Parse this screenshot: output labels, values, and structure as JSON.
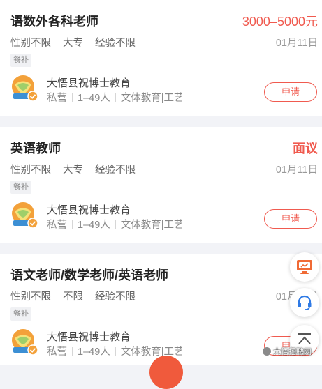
{
  "jobs": [
    {
      "title": "语数外各科老师",
      "salary": "3000–5000元",
      "requirements": [
        "性别不限",
        "大专",
        "经验不限"
      ],
      "date": "01月11日",
      "tag": "餐补",
      "company": {
        "name": "大悟县祝博士教育",
        "info": [
          "私营",
          "1–49人",
          "文体教育|工艺"
        ]
      },
      "apply_label": "申请"
    },
    {
      "title": "英语教师",
      "salary": "面议",
      "requirements": [
        "性别不限",
        "大专",
        "经验不限"
      ],
      "date": "01月11日",
      "tag": "餐补",
      "company": {
        "name": "大悟县祝博士教育",
        "info": [
          "私营",
          "1–49人",
          "文体教育|工艺"
        ]
      },
      "apply_label": "申请"
    },
    {
      "title": "语文老师/数学老师/英语老师",
      "salary": "",
      "requirements": [
        "性别不限",
        "不限",
        "经验不限"
      ],
      "date": "01月11日",
      "tag": "餐补",
      "company": {
        "name": "大悟县祝博士教育",
        "info": [
          "私营",
          "1–49人",
          "文体教育|工艺"
        ]
      },
      "apply_label": "申请"
    }
  ],
  "floating": {
    "icons": [
      "monitor-icon",
      "customer-service-icon",
      "back-to-top-icon"
    ]
  },
  "watermark": "大悟招聘网",
  "colors": {
    "accent": "#f05a4f",
    "background": "#f2f3f7",
    "orange_icon": "#f06a35",
    "blue_icon": "#2f7ae5"
  }
}
